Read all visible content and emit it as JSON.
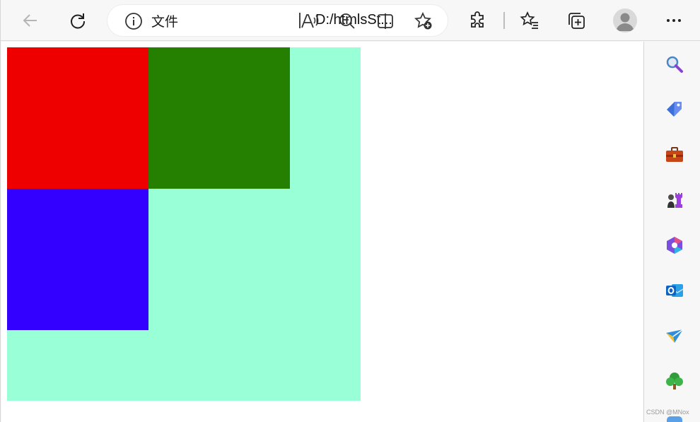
{
  "browser": {
    "address_bar": {
      "info_label": "文件",
      "url": "D:/htmlsSt..."
    }
  },
  "page": {
    "outer_box_color": "#99ffd6",
    "boxes": [
      {
        "name": "red-box",
        "color": "#ef0000"
      },
      {
        "name": "green-box",
        "color": "#257f00"
      },
      {
        "name": "blue-box",
        "color": "#3300ff"
      }
    ]
  },
  "sidebar": {
    "items": [
      {
        "name": "search-icon"
      },
      {
        "name": "shopping-tag-icon"
      },
      {
        "name": "toolbox-icon"
      },
      {
        "name": "games-chess-icon"
      },
      {
        "name": "office-icon"
      },
      {
        "name": "outlook-icon"
      },
      {
        "name": "send-plane-icon"
      },
      {
        "name": "tree-icon"
      }
    ]
  },
  "watermark": "CSDN @MNox",
  "colors": {
    "chrome_background": "#f7f7f7",
    "accent_purple": "#8c3fd8"
  }
}
